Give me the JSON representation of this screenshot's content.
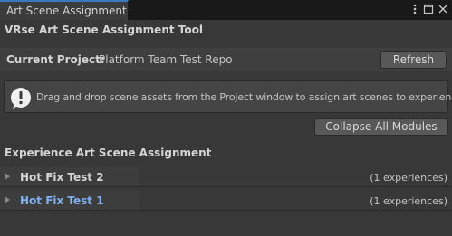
{
  "window": {
    "tab_title": "Art Scene Assignment",
    "buttons": [
      "more-vertical-icon",
      "maximize-icon",
      "close-icon"
    ]
  },
  "tool": {
    "title": "VRse Art Scene Assignment Tool"
  },
  "project": {
    "label": "Current Project:",
    "value": "Platform Team Test Repo",
    "refresh_label": "Refresh"
  },
  "help": {
    "icon": "info-icon",
    "text": "Drag and drop scene assets from the Project window to assign art scenes to experiences."
  },
  "collapse_label": "Collapse All Modules",
  "section": {
    "title": "Experience Art Scene Assignment"
  },
  "modules": [
    {
      "name": "Hot Fix Test 2",
      "count": "(1 experiences)",
      "highlighted": false
    },
    {
      "name": "Hot Fix Test 1",
      "count": "(1 experiences)",
      "highlighted": true
    }
  ],
  "colors": {
    "accent": "#3a79bb",
    "highlight_text": "#7fb0f0",
    "background": "#383838"
  }
}
